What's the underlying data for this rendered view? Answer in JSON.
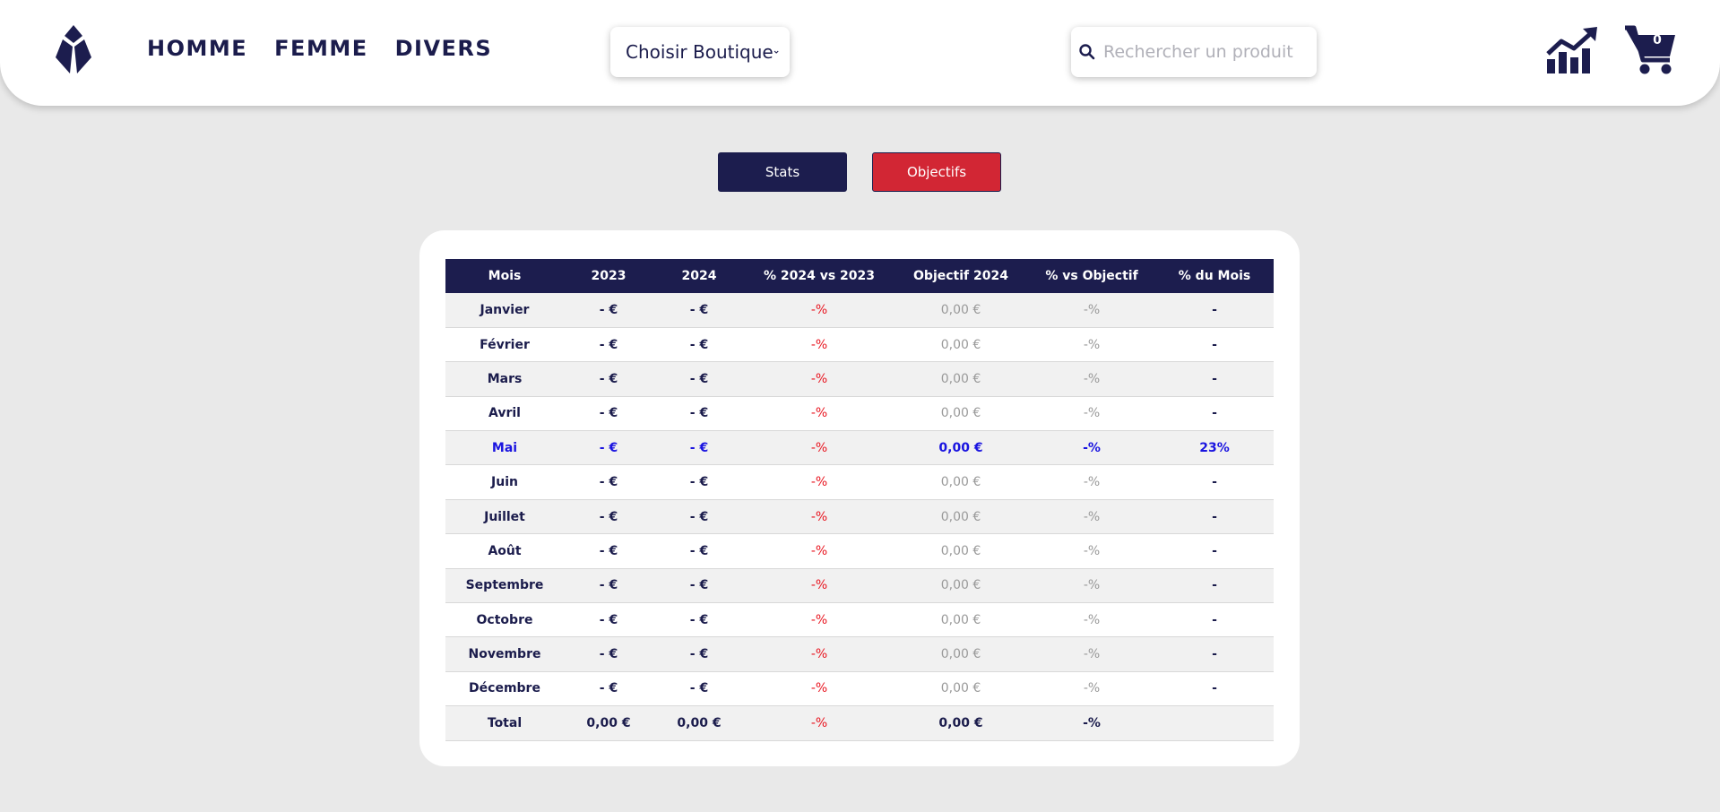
{
  "header": {
    "logo_name": "brand-logo",
    "nav": [
      "HOMME",
      "FEMME",
      "DIVERS"
    ],
    "shop_select": {
      "selected": "Choisir Boutique"
    },
    "search": {
      "placeholder": "Rechercher un produit"
    },
    "cart_count": "0"
  },
  "tabs": {
    "stats": "Stats",
    "objectives": "Objectifs"
  },
  "colors": {
    "navy": "#1c1d4e",
    "red": "#d22634",
    "highlight_blue": "#1a14e0",
    "negative_red": "#e8141f"
  },
  "table": {
    "headers": [
      "Mois",
      "2023",
      "2024",
      "% 2024 vs 2023",
      "Objectif 2024",
      "% vs Objectif",
      "% du Mois"
    ],
    "rows": [
      [
        "Janvier",
        "- €",
        "- €",
        "-%",
        "0,00 €",
        "-%",
        "-"
      ],
      [
        "Février",
        "- €",
        "- €",
        "-%",
        "0,00 €",
        "-%",
        "-"
      ],
      [
        "Mars",
        "- €",
        "- €",
        "-%",
        "0,00 €",
        "-%",
        "-"
      ],
      [
        "Avril",
        "- €",
        "- €",
        "-%",
        "0,00 €",
        "-%",
        "-"
      ],
      [
        "Mai",
        "- €",
        "- €",
        "-%",
        "0,00 €",
        "-%",
        "23%"
      ],
      [
        "Juin",
        "- €",
        "- €",
        "-%",
        "0,00 €",
        "-%",
        "-"
      ],
      [
        "Juillet",
        "- €",
        "- €",
        "-%",
        "0,00 €",
        "-%",
        "-"
      ],
      [
        "Août",
        "- €",
        "- €",
        "-%",
        "0,00 €",
        "-%",
        "-"
      ],
      [
        "Septembre",
        "- €",
        "- €",
        "-%",
        "0,00 €",
        "-%",
        "-"
      ],
      [
        "Octobre",
        "- €",
        "- €",
        "-%",
        "0,00 €",
        "-%",
        "-"
      ],
      [
        "Novembre",
        "- €",
        "- €",
        "-%",
        "0,00 €",
        "-%",
        "-"
      ],
      [
        "Décembre",
        "- €",
        "- €",
        "-%",
        "0,00 €",
        "-%",
        "-"
      ]
    ],
    "current_month_index": 4,
    "total": [
      "Total",
      "0,00 €",
      "0,00 €",
      "-%",
      "0,00 €",
      "-%",
      ""
    ]
  }
}
